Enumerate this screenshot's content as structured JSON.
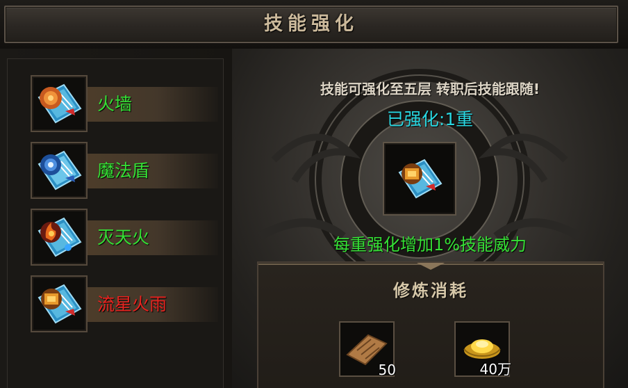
{
  "title": "技能强化",
  "skills": [
    {
      "name": "火墙",
      "color": "#35e035",
      "icon": "fire-wall-skill-icon"
    },
    {
      "name": "魔法盾",
      "color": "#35e035",
      "icon": "magic-shield-skill-icon"
    },
    {
      "name": "灭天火",
      "color": "#35e035",
      "icon": "heaven-fire-skill-icon"
    },
    {
      "name": "流星火雨",
      "color": "#e8231f",
      "icon": "meteor-fire-rain-skill-icon"
    }
  ],
  "info": {
    "hint": "技能可强化至五层 转职后技能跟随!",
    "enhanced_label": "已强化:1重",
    "bonus": "每重强化增加1%技能威力"
  },
  "cost": {
    "title": "修炼消耗",
    "items": [
      {
        "icon": "scroll-icon",
        "count": "50"
      },
      {
        "icon": "gold-ingot-icon",
        "count": "40万"
      }
    ]
  },
  "colors": {
    "green": "#35e035",
    "cyan": "#29d6e0",
    "red": "#e8231f",
    "gold_text": "#cbb99b"
  }
}
